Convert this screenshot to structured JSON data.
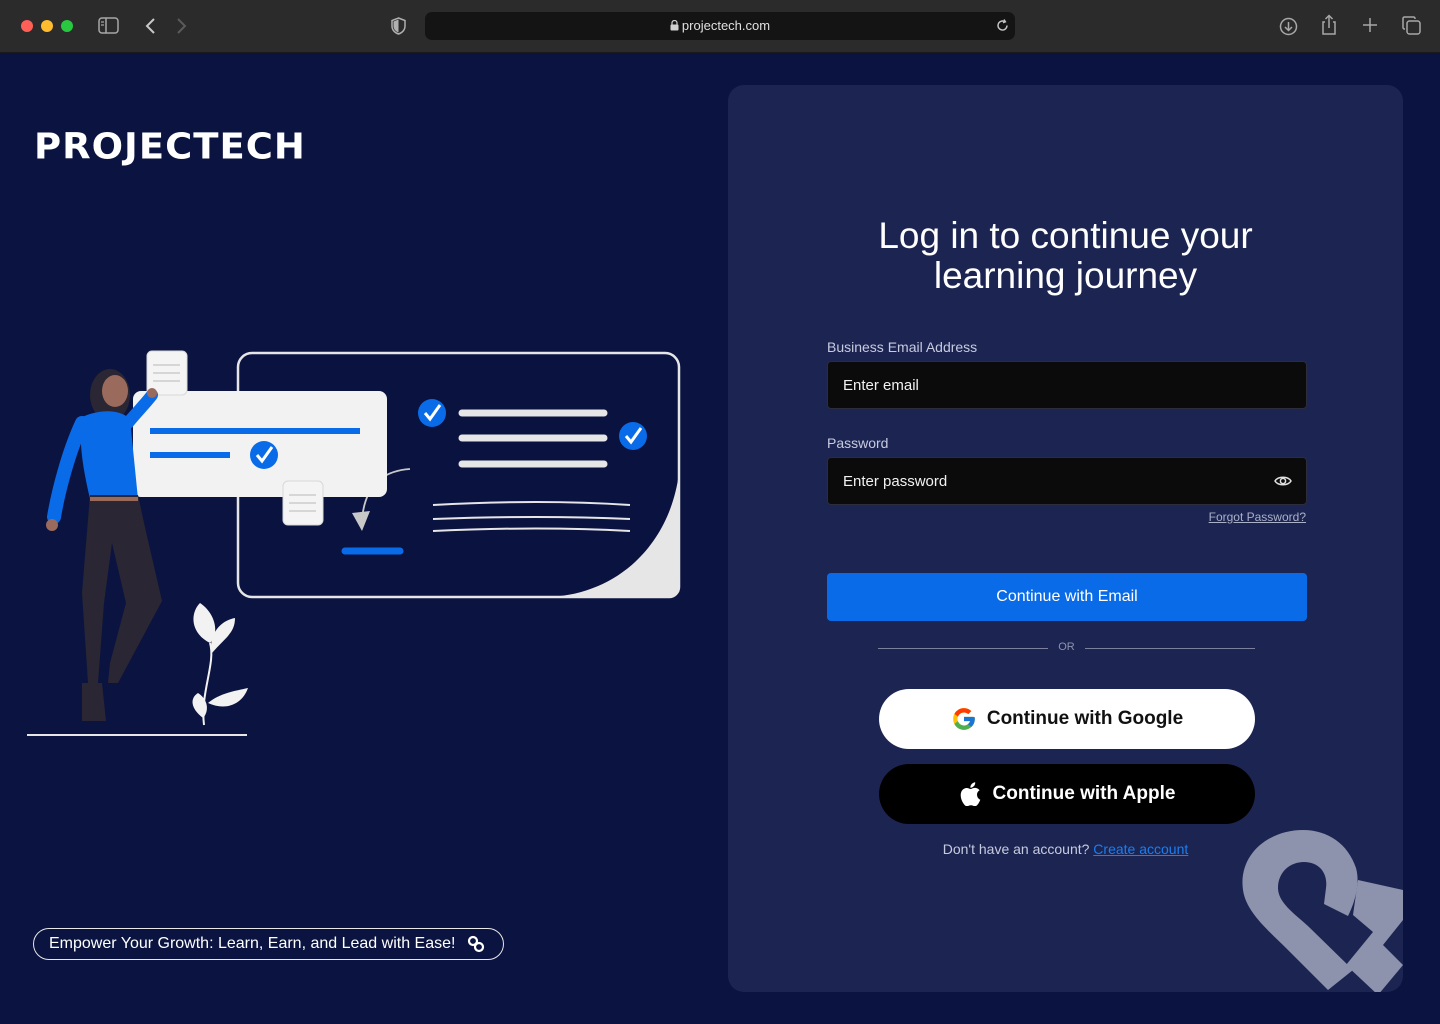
{
  "browser": {
    "url": "projectech.com"
  },
  "brand": {
    "logo_text": "PROJECTECH"
  },
  "tagline": {
    "text": "Empower Your Growth: Learn, Earn, and Lead with Ease!"
  },
  "login": {
    "heading_line1": "Log in to continue your",
    "heading_line2": "learning journey",
    "email_label": "Business Email Address",
    "email_placeholder": "Enter email",
    "password_label": "Password",
    "password_placeholder": "Enter password",
    "forgot_label": "Forgot Password?",
    "email_button": "Continue with Email",
    "or_label": "OR",
    "google_button": "Continue with Google",
    "apple_button": "Continue with Apple",
    "no_account_text": "Don't have an account?",
    "create_account_link": "Create account"
  },
  "colors": {
    "page_bg": "#0b1340",
    "card_bg": "#1c2552",
    "primary": "#0a6be8"
  }
}
